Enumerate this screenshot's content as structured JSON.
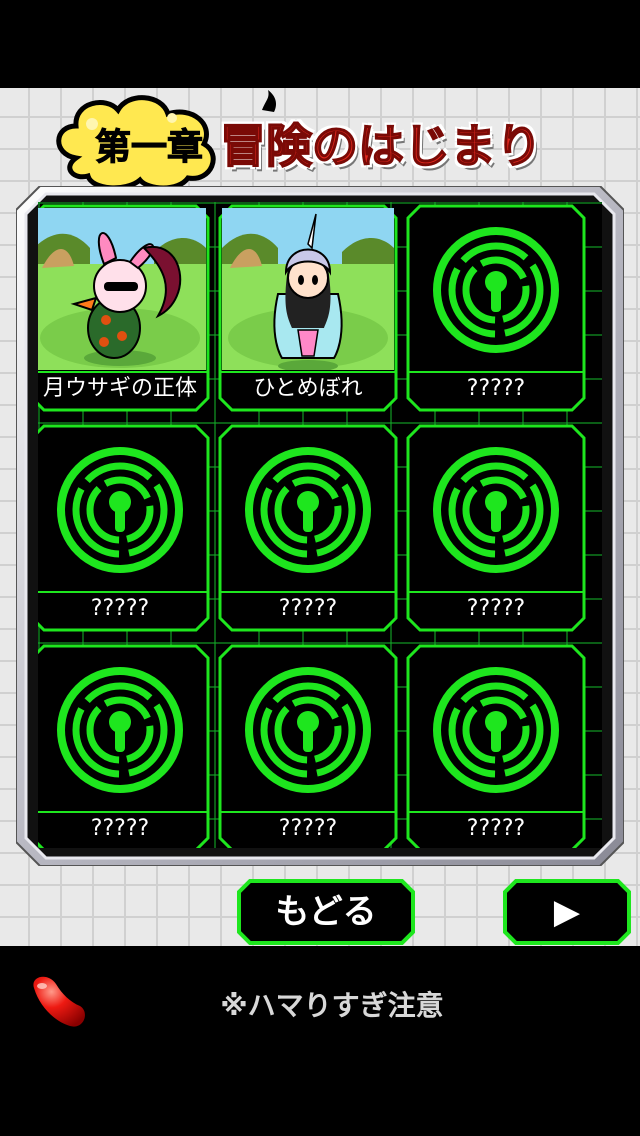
{
  "header": {
    "chapter_label": "第一章",
    "chapter_title": "冒険のはじまり"
  },
  "episodes": [
    {
      "title": "月ウサギの正体",
      "unlocked": true,
      "icon": "character-rabbit-villain"
    },
    {
      "title": "ひとめぼれ",
      "unlocked": true,
      "icon": "character-hero-girl"
    },
    {
      "title": "?????",
      "unlocked": false,
      "icon": "lock-icon"
    },
    {
      "title": "?????",
      "unlocked": false,
      "icon": "lock-icon"
    },
    {
      "title": "?????",
      "unlocked": false,
      "icon": "lock-icon"
    },
    {
      "title": "?????",
      "unlocked": false,
      "icon": "lock-icon"
    },
    {
      "title": "?????",
      "unlocked": false,
      "icon": "lock-icon"
    },
    {
      "title": "?????",
      "unlocked": false,
      "icon": "lock-icon"
    },
    {
      "title": "?????",
      "unlocked": false,
      "icon": "lock-icon"
    }
  ],
  "buttons": {
    "back_label": "もどる",
    "next_label": "▶"
  },
  "footer": {
    "warning": "※ハマりすぎ注意",
    "icon": "red-bean-icon"
  },
  "colors": {
    "neon_green": "#1ee61e",
    "title_red": "#e0281e",
    "cloud_yellow": "#ffe850"
  }
}
